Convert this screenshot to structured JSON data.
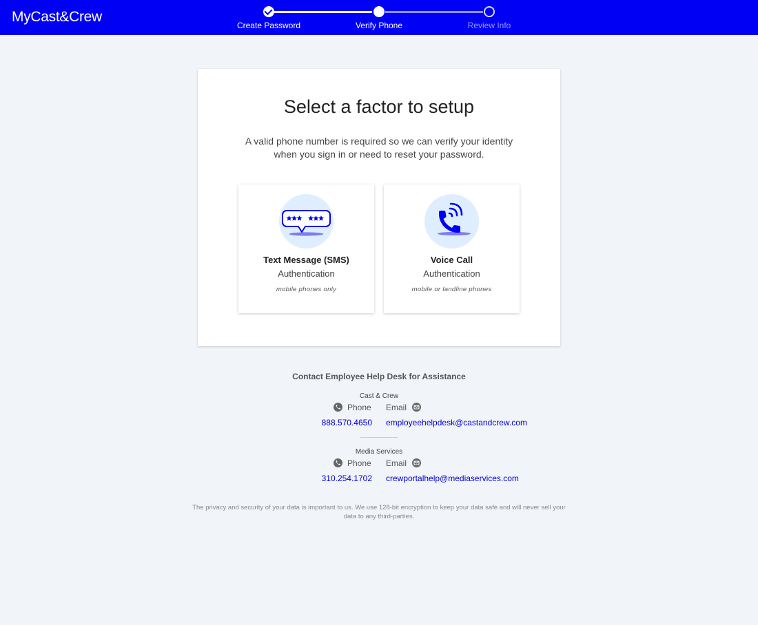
{
  "header": {
    "logo": "MyCast&Crew",
    "steps": [
      {
        "label": "Create Password",
        "state": "complete"
      },
      {
        "label": "Verify Phone",
        "state": "current"
      },
      {
        "label": "Review Info",
        "state": "upcoming"
      }
    ]
  },
  "card": {
    "title": "Select a factor to setup",
    "description": "A valid phone number is required so we can verify your identity when you sign in or need to reset your password.",
    "options": [
      {
        "title": "Text Message (SMS)",
        "subtitle": "Authentication",
        "note": "mobile phones only",
        "icon": "sms-icon"
      },
      {
        "title": "Voice Call",
        "subtitle": "Authentication",
        "note": "mobile or landline phones",
        "icon": "voice-call-icon"
      }
    ]
  },
  "help": {
    "title": "Contact Employee Help Desk for Assistance",
    "groups": [
      {
        "name": "Cast & Crew",
        "phone_label": "Phone",
        "email_label": "Email",
        "phone": "888.570.4650",
        "email": "employeehelpdesk@castandcrew.com"
      },
      {
        "name": "Media Services",
        "phone_label": "Phone",
        "email_label": "Email",
        "phone": "310.254.1702",
        "email": "crewportalhelp@mediaservices.com"
      }
    ]
  },
  "privacy": "The privacy and security of your data is important to us. We use 128-bit encryption to keep your data safe and will never sell your data to any third-parties.",
  "colors": {
    "brand_blue": "#0000f5",
    "link_blue": "#0000d8",
    "background": "#f1f4f8",
    "icon_bg": "#dfeeff"
  }
}
